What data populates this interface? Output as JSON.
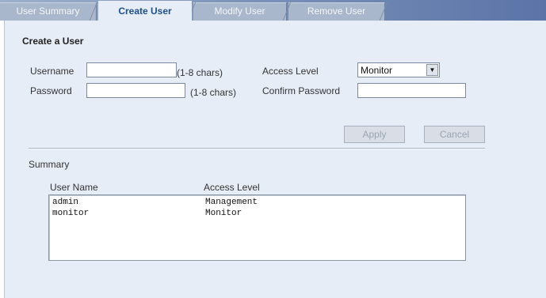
{
  "tabs": [
    {
      "label": "User Summary"
    },
    {
      "label": "Create User"
    },
    {
      "label": "Modify User"
    },
    {
      "label": "Remove User"
    }
  ],
  "form": {
    "title": "Create a User",
    "username_label": "Username",
    "username_value": "",
    "username_hint": "(1-8 chars)",
    "password_label": "Password",
    "password_value": "",
    "password_hint": "(1-8 chars)",
    "access_level_label": "Access Level",
    "access_level_value": "Monitor",
    "confirm_password_label": "Confirm Password",
    "confirm_password_value": ""
  },
  "buttons": {
    "apply": "Apply",
    "cancel": "Cancel"
  },
  "summary": {
    "label": "Summary",
    "columns": [
      "User Name",
      "Access Level"
    ],
    "rows": [
      [
        "admin",
        "Management"
      ],
      [
        "monitor",
        "Monitor"
      ]
    ]
  }
}
